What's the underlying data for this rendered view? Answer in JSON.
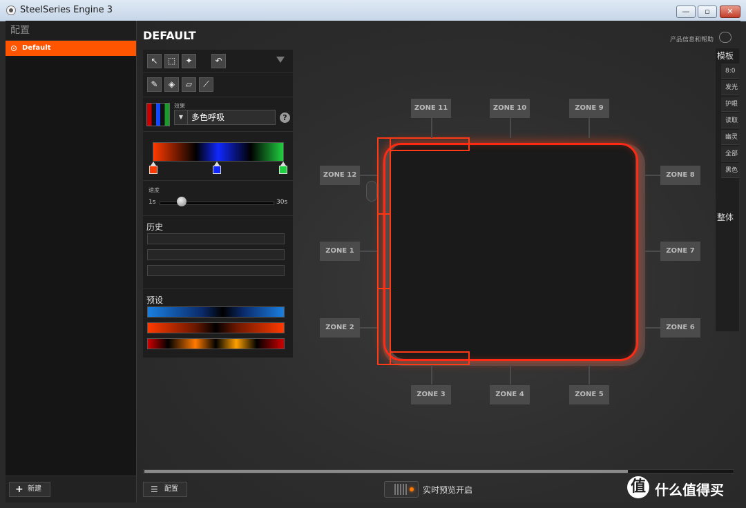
{
  "window": {
    "title": "SteelSeries Engine 3",
    "min_label": "—",
    "max_label": "▫",
    "close_label": "✕"
  },
  "sidebar": {
    "header": "配置",
    "items": [
      {
        "label": "Default",
        "selected": true
      }
    ],
    "new_button": "新建"
  },
  "main": {
    "title": "DEFAULT",
    "help_text": "产品信息和帮助",
    "effect": {
      "label": "效果",
      "value": "多色呼吸"
    },
    "speed": {
      "label": "速度",
      "min": "1s",
      "max": "30s"
    },
    "history_label": "历史",
    "presets_label": "预设",
    "zones": {
      "z1": "ZONE 1",
      "z2": "ZONE 2",
      "z3": "ZONE 3",
      "z4": "ZONE 4",
      "z5": "ZONE 5",
      "z6": "ZONE 6",
      "z7": "ZONE 7",
      "z8": "ZONE 8",
      "z9": "ZONE 9",
      "z10": "ZONE 10",
      "z11": "ZONE 11",
      "z12": "ZONE 12"
    },
    "footer": {
      "config_button": "配置",
      "preview_label": "实时预览开启"
    }
  },
  "right_panel": {
    "header": "模板",
    "items": [
      "8:0",
      "发光",
      "护眼",
      "读取",
      "幽灵",
      "全部",
      "黑色"
    ],
    "header2": "整体"
  },
  "watermark": {
    "logo": "值",
    "text": "什么值得买"
  },
  "colors": {
    "accent": "#ff5500",
    "zone_glow": "#ff2a14",
    "stop1": "#ff3a00",
    "stop2": "#1028ff",
    "stop3": "#20d040"
  }
}
